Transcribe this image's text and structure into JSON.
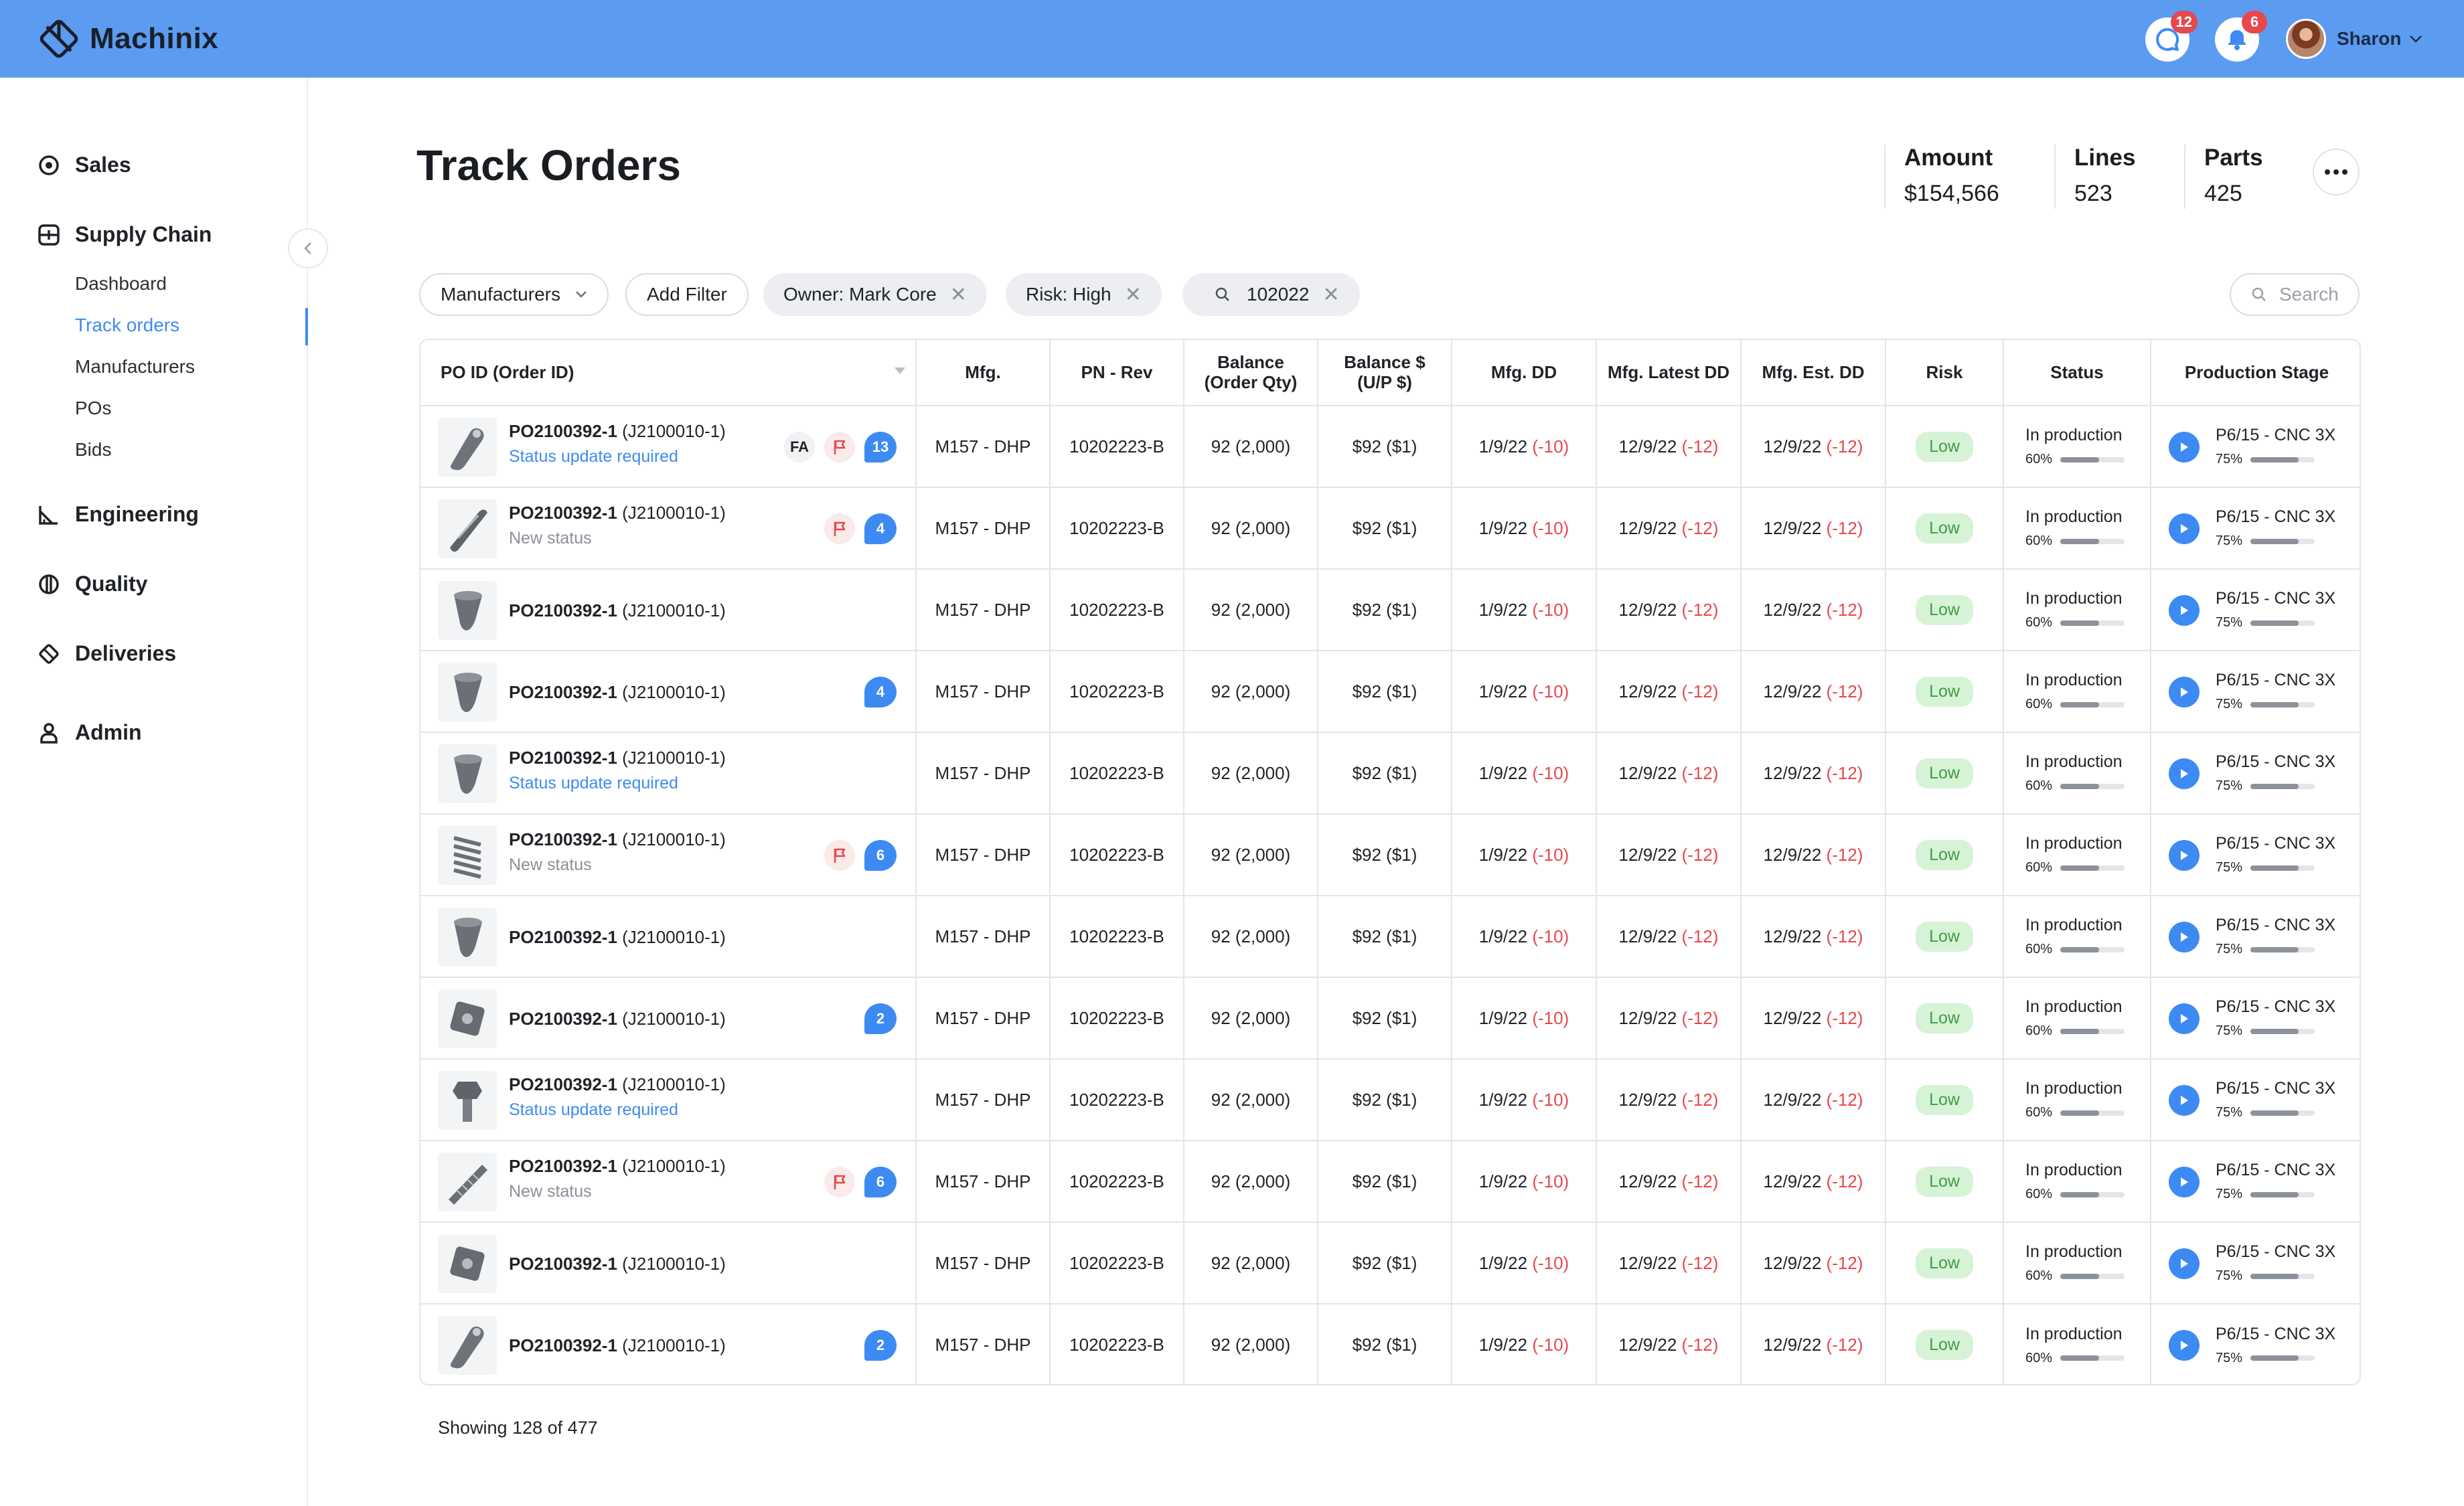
{
  "app": {
    "name": "Machinix"
  },
  "topbar": {
    "messages_badge": "12",
    "notifications_badge": "6",
    "user_name": "Sharon"
  },
  "sidebar": {
    "sections": [
      {
        "label": "Sales",
        "icon": "target-icon"
      },
      {
        "label": "Supply Chain",
        "icon": "supply-chain-icon"
      },
      {
        "label": "Engineering",
        "icon": "ruler-icon"
      },
      {
        "label": "Quality",
        "icon": "quality-icon"
      },
      {
        "label": "Deliveries",
        "icon": "tag-icon"
      },
      {
        "label": "Admin",
        "icon": "user-icon"
      }
    ],
    "supply_chain_items": [
      "Dashboard",
      "Track orders",
      "Manufacturers",
      "POs",
      "Bids"
    ],
    "active_item": "Track orders"
  },
  "page": {
    "title": "Track Orders",
    "stats": [
      {
        "label": "Amount",
        "value": "$154,566"
      },
      {
        "label": "Lines",
        "value": "523"
      },
      {
        "label": "Parts",
        "value": "425"
      }
    ]
  },
  "filters": {
    "manufacturers": "Manufacturers",
    "add_filter": "Add Filter",
    "owner": "Owner: Mark Core",
    "risk": "Risk: High",
    "query": "102022",
    "search_placeholder": "Search"
  },
  "table": {
    "columns": {
      "po": "PO ID (Order ID)",
      "mfg": "Mfg.",
      "pn": "PN - Rev",
      "balance_line1": "Balance",
      "balance_line2": "(Order Qty)",
      "balance_usd_line1": "Balance $",
      "balance_usd_line2": "(U/P $)",
      "mfg_dd": "Mfg. DD",
      "mfg_latest_dd": "Mfg. Latest DD",
      "mfg_est_dd": "Mfg. Est. DD",
      "risk": "Risk",
      "status": "Status",
      "production_stage": "Production Stage"
    },
    "rows": [
      {
        "po": "PO2100392-1",
        "order": "(J2100010-1)",
        "sub": "Status update required",
        "sub_type": "status",
        "fa": true,
        "flag": true,
        "count": "13",
        "part": "bracket",
        "mfg": "M157 - DHP",
        "pn": "10202223-B",
        "balance": "92 (2,000)",
        "balance_usd": "$92 ($1)",
        "dd": "1/9/22",
        "dd_delta": "(-10)",
        "latest": "12/9/22",
        "latest_delta": "(-12)",
        "est": "12/9/22",
        "est_delta": "(-12)",
        "risk": "Low",
        "status": "In production",
        "status_pct": "60%",
        "stage": "P6/15 - CNC 3X",
        "stage_pct": "75%"
      },
      {
        "po": "PO2100392-1",
        "order": "(J2100010-1)",
        "sub": "New status",
        "sub_type": "new",
        "fa": false,
        "flag": true,
        "count": "4",
        "part": "rod",
        "mfg": "M157 - DHP",
        "pn": "10202223-B",
        "balance": "92 (2,000)",
        "balance_usd": "$92 ($1)",
        "dd": "1/9/22",
        "dd_delta": "(-10)",
        "latest": "12/9/22",
        "latest_delta": "(-12)",
        "est": "12/9/22",
        "est_delta": "(-12)",
        "risk": "Low",
        "status": "In production",
        "status_pct": "60%",
        "stage": "P6/15 - CNC 3X",
        "stage_pct": "75%"
      },
      {
        "po": "PO2100392-1",
        "order": "(J2100010-1)",
        "sub": "",
        "sub_type": "none",
        "fa": false,
        "flag": false,
        "count": "",
        "part": "cone",
        "mfg": "M157 - DHP",
        "pn": "10202223-B",
        "balance": "92 (2,000)",
        "balance_usd": "$92 ($1)",
        "dd": "1/9/22",
        "dd_delta": "(-10)",
        "latest": "12/9/22",
        "latest_delta": "(-12)",
        "est": "12/9/22",
        "est_delta": "(-12)",
        "risk": "Low",
        "status": "In production",
        "status_pct": "60%",
        "stage": "P6/15 - CNC 3X",
        "stage_pct": "75%"
      },
      {
        "po": "PO2100392-1",
        "order": "(J2100010-1)",
        "sub": "",
        "sub_type": "none",
        "fa": false,
        "flag": false,
        "count": "4",
        "part": "cone",
        "mfg": "M157 - DHP",
        "pn": "10202223-B",
        "balance": "92 (2,000)",
        "balance_usd": "$92 ($1)",
        "dd": "1/9/22",
        "dd_delta": "(-10)",
        "latest": "12/9/22",
        "latest_delta": "(-12)",
        "est": "12/9/22",
        "est_delta": "(-12)",
        "risk": "Low",
        "status": "In production",
        "status_pct": "60%",
        "stage": "P6/15 - CNC 3X",
        "stage_pct": "75%"
      },
      {
        "po": "PO2100392-1",
        "order": "(J2100010-1)",
        "sub": "Status update required",
        "sub_type": "status",
        "fa": false,
        "flag": false,
        "count": "",
        "part": "cone",
        "mfg": "M157 - DHP",
        "pn": "10202223-B",
        "balance": "92 (2,000)",
        "balance_usd": "$92 ($1)",
        "dd": "1/9/22",
        "dd_delta": "(-10)",
        "latest": "12/9/22",
        "latest_delta": "(-12)",
        "est": "12/9/22",
        "est_delta": "(-12)",
        "risk": "Low",
        "status": "In production",
        "status_pct": "60%",
        "stage": "P6/15 - CNC 3X",
        "stage_pct": "75%"
      },
      {
        "po": "PO2100392-1",
        "order": "(J2100010-1)",
        "sub": "New status",
        "sub_type": "new",
        "fa": false,
        "flag": true,
        "count": "6",
        "part": "spring",
        "mfg": "M157 - DHP",
        "pn": "10202223-B",
        "balance": "92 (2,000)",
        "balance_usd": "$92 ($1)",
        "dd": "1/9/22",
        "dd_delta": "(-10)",
        "latest": "12/9/22",
        "latest_delta": "(-12)",
        "est": "12/9/22",
        "est_delta": "(-12)",
        "risk": "Low",
        "status": "In production",
        "status_pct": "60%",
        "stage": "P6/15 - CNC 3X",
        "stage_pct": "75%"
      },
      {
        "po": "PO2100392-1",
        "order": "(J2100010-1)",
        "sub": "",
        "sub_type": "none",
        "fa": false,
        "flag": false,
        "count": "",
        "part": "cone",
        "mfg": "M157 - DHP",
        "pn": "10202223-B",
        "balance": "92 (2,000)",
        "balance_usd": "$92 ($1)",
        "dd": "1/9/22",
        "dd_delta": "(-10)",
        "latest": "12/9/22",
        "latest_delta": "(-12)",
        "est": "12/9/22",
        "est_delta": "(-12)",
        "risk": "Low",
        "status": "In production",
        "status_pct": "60%",
        "stage": "P6/15 - CNC 3X",
        "stage_pct": "75%"
      },
      {
        "po": "PO2100392-1",
        "order": "(J2100010-1)",
        "sub": "",
        "sub_type": "none",
        "fa": false,
        "flag": false,
        "count": "2",
        "part": "block",
        "mfg": "M157 - DHP",
        "pn": "10202223-B",
        "balance": "92 (2,000)",
        "balance_usd": "$92 ($1)",
        "dd": "1/9/22",
        "dd_delta": "(-10)",
        "latest": "12/9/22",
        "latest_delta": "(-12)",
        "est": "12/9/22",
        "est_delta": "(-12)",
        "risk": "Low",
        "status": "In production",
        "status_pct": "60%",
        "stage": "P6/15 - CNC 3X",
        "stage_pct": "75%"
      },
      {
        "po": "PO2100392-1",
        "order": "(J2100010-1)",
        "sub": "Status update required",
        "sub_type": "status",
        "fa": false,
        "flag": false,
        "count": "",
        "part": "bolt",
        "mfg": "M157 - DHP",
        "pn": "10202223-B",
        "balance": "92 (2,000)",
        "balance_usd": "$92 ($1)",
        "dd": "1/9/22",
        "dd_delta": "(-10)",
        "latest": "12/9/22",
        "latest_delta": "(-12)",
        "est": "12/9/22",
        "est_delta": "(-12)",
        "risk": "Low",
        "status": "In production",
        "status_pct": "60%",
        "stage": "P6/15 - CNC 3X",
        "stage_pct": "75%"
      },
      {
        "po": "PO2100392-1",
        "order": "(J2100010-1)",
        "sub": "New status",
        "sub_type": "new",
        "fa": false,
        "flag": true,
        "count": "6",
        "part": "screw",
        "mfg": "M157 - DHP",
        "pn": "10202223-B",
        "balance": "92 (2,000)",
        "balance_usd": "$92 ($1)",
        "dd": "1/9/22",
        "dd_delta": "(-10)",
        "latest": "12/9/22",
        "latest_delta": "(-12)",
        "est": "12/9/22",
        "est_delta": "(-12)",
        "risk": "Low",
        "status": "In production",
        "status_pct": "60%",
        "stage": "P6/15 - CNC 3X",
        "stage_pct": "75%"
      },
      {
        "po": "PO2100392-1",
        "order": "(J2100010-1)",
        "sub": "",
        "sub_type": "none",
        "fa": false,
        "flag": false,
        "count": "",
        "part": "block",
        "mfg": "M157 - DHP",
        "pn": "10202223-B",
        "balance": "92 (2,000)",
        "balance_usd": "$92 ($1)",
        "dd": "1/9/22",
        "dd_delta": "(-10)",
        "latest": "12/9/22",
        "latest_delta": "(-12)",
        "est": "12/9/22",
        "est_delta": "(-12)",
        "risk": "Low",
        "status": "In production",
        "status_pct": "60%",
        "stage": "P6/15 - CNC 3X",
        "stage_pct": "75%"
      },
      {
        "po": "PO2100392-1",
        "order": "(J2100010-1)",
        "sub": "",
        "sub_type": "none",
        "fa": false,
        "flag": false,
        "count": "2",
        "part": "bracket",
        "mfg": "M157 - DHP",
        "pn": "10202223-B",
        "balance": "92 (2,000)",
        "balance_usd": "$92 ($1)",
        "dd": "1/9/22",
        "dd_delta": "(-10)",
        "latest": "12/9/22",
        "latest_delta": "(-12)",
        "est": "12/9/22",
        "est_delta": "(-12)",
        "risk": "Low",
        "status": "In production",
        "status_pct": "60%",
        "stage": "P6/15 - CNC 3X",
        "stage_pct": "75%"
      }
    ],
    "footer": "Showing 128 of 477"
  },
  "colors": {
    "topbar": "#5b9cf1",
    "accent": "#3d8bf2",
    "danger": "#e5484d",
    "risk_low_bg": "#d6f3d6",
    "risk_low_text": "#3f9c47"
  }
}
